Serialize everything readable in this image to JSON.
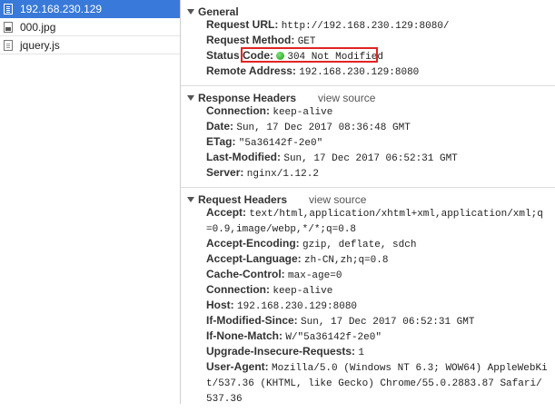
{
  "requests": [
    {
      "name": "192.168.230.129",
      "icon": "document-icon",
      "selected": true
    },
    {
      "name": "000.jpg",
      "icon": "image-file-icon",
      "selected": false
    },
    {
      "name": "jquery.js",
      "icon": "script-file-icon",
      "selected": false
    }
  ],
  "general": {
    "title": "General",
    "rows": [
      {
        "key": "Request URL:",
        "value": "http://192.168.230.129:8080/"
      },
      {
        "key": "Request Method:",
        "value": "GET"
      },
      {
        "key": "Status Code:",
        "value": "304 Not Modified"
      },
      {
        "key": "Remote Address:",
        "value": "192.168.230.129:8080"
      }
    ]
  },
  "response_headers": {
    "title": "Response Headers",
    "view_source": "view source",
    "rows": [
      {
        "key": "Connection:",
        "value": "keep-alive"
      },
      {
        "key": "Date:",
        "value": "Sun, 17 Dec 2017 08:36:48 GMT"
      },
      {
        "key": "ETag:",
        "value": "\"5a36142f-2e0\""
      },
      {
        "key": "Last-Modified:",
        "value": "Sun, 17 Dec 2017 06:52:31 GMT"
      },
      {
        "key": "Server:",
        "value": "nginx/1.12.2"
      }
    ]
  },
  "request_headers": {
    "title": "Request Headers",
    "view_source": "view source",
    "rows": [
      {
        "key": "Accept:",
        "value": "text/html,application/xhtml+xml,application/xml;q=0.9,image/webp,*/*;q=0.8"
      },
      {
        "key": "Accept-Encoding:",
        "value": "gzip, deflate, sdch"
      },
      {
        "key": "Accept-Language:",
        "value": "zh-CN,zh;q=0.8"
      },
      {
        "key": "Cache-Control:",
        "value": "max-age=0"
      },
      {
        "key": "Connection:",
        "value": "keep-alive"
      },
      {
        "key": "Host:",
        "value": "192.168.230.129:8080"
      },
      {
        "key": "If-Modified-Since:",
        "value": "Sun, 17 Dec 2017 06:52:31 GMT"
      },
      {
        "key": "If-None-Match:",
        "value": "W/\"5a36142f-2e0\""
      },
      {
        "key": "Upgrade-Insecure-Requests:",
        "value": "1"
      },
      {
        "key": "User-Agent:",
        "value": "Mozilla/5.0 (Windows NT 6.3; WOW64) AppleWebKit/537.36 (KHTML, like Gecko) Chrome/55.0.2883.87 Safari/537.36"
      }
    ]
  },
  "colors": {
    "selected": "#3879d9",
    "highlight": "#e02424",
    "status_ok": "#1f9a1a"
  }
}
